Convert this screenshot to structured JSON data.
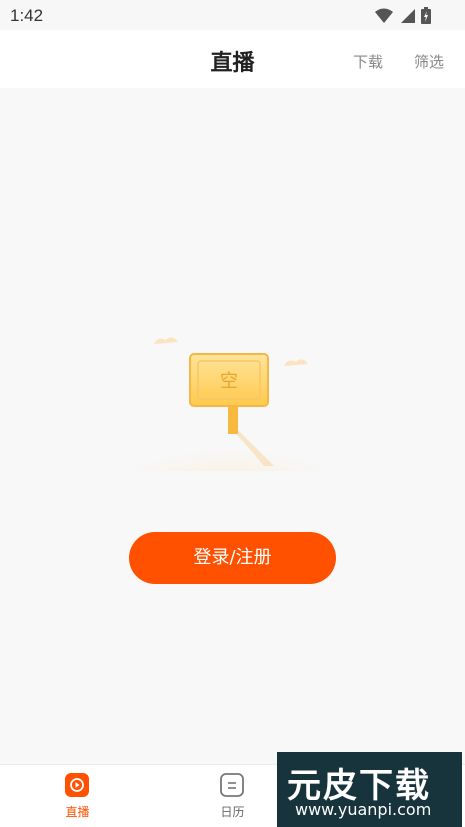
{
  "status_bar": {
    "time": "1:42"
  },
  "header": {
    "title": "直播",
    "download_label": "下载",
    "filter_label": "筛选"
  },
  "empty_state": {
    "sign_text": "空"
  },
  "login_button": {
    "label": "登录/注册"
  },
  "tabs": [
    {
      "label": "直播",
      "icon": "play-icon",
      "active": true
    },
    {
      "label": "日历",
      "icon": "calendar-icon",
      "active": false
    }
  ],
  "watermark": {
    "logo_text": "元皮下载",
    "url": "www.yuanpi.com"
  },
  "colors": {
    "accent": "#ff5100",
    "watermark_bg": "#17333c"
  }
}
